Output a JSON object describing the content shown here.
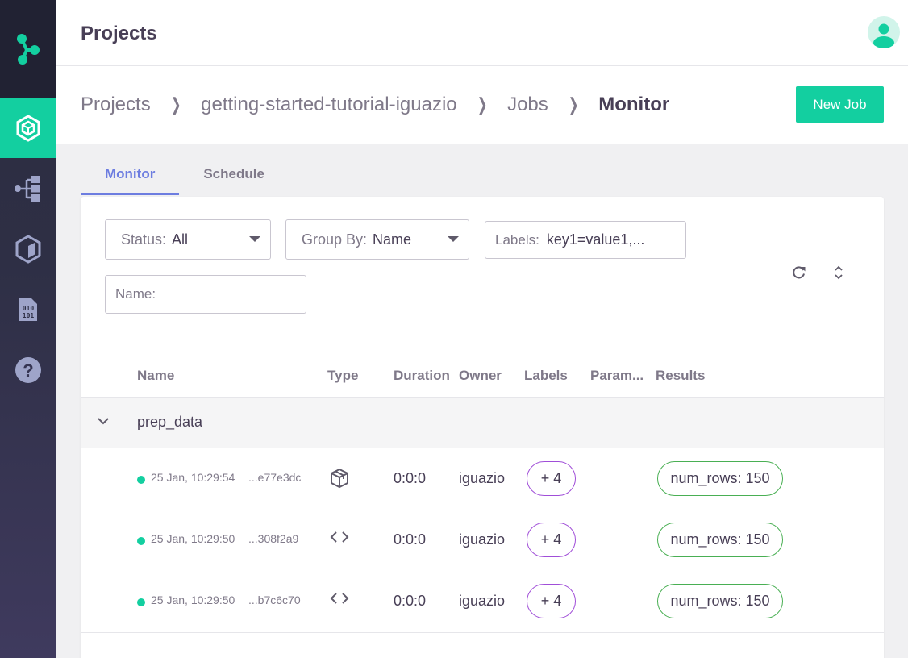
{
  "header": {
    "title": "Projects"
  },
  "breadcrumb": {
    "items": [
      "Projects",
      "getting-started-tutorial-iguazio",
      "Jobs",
      "Monitor"
    ]
  },
  "actions": {
    "new_job_label": "New Job"
  },
  "tabs": [
    {
      "label": "Monitor",
      "active": true
    },
    {
      "label": "Schedule",
      "active": false
    }
  ],
  "filters": {
    "status": {
      "label": "Status:",
      "value": "All"
    },
    "group_by": {
      "label": "Group By:",
      "value": "Name"
    },
    "labels": {
      "label": "Labels:",
      "placeholder": "key1=value1,..."
    },
    "name": {
      "label": "Name:",
      "value": ""
    }
  },
  "table": {
    "columns": [
      "Name",
      "Type",
      "Duration",
      "Owner",
      "Labels",
      "Param...",
      "Results"
    ],
    "group": {
      "name": "prep_data"
    },
    "rows": [
      {
        "date": "25 Jan, 10:29:54",
        "uid": "...e77e3dc",
        "type_icon": "package-icon",
        "duration": "0:0:0",
        "owner": "iguazio",
        "labels": "+ 4",
        "result": "num_rows: 150"
      },
      {
        "date": "25 Jan, 10:29:50",
        "uid": "...308f2a9",
        "type_icon": "code-icon",
        "duration": "0:0:0",
        "owner": "iguazio",
        "labels": "+ 4",
        "result": "num_rows: 150"
      },
      {
        "date": "25 Jan, 10:29:50",
        "uid": "...b7c6c70",
        "type_icon": "code-icon",
        "duration": "0:0:0",
        "owner": "iguazio",
        "labels": "+ 4",
        "result": "num_rows: 150"
      }
    ]
  },
  "colors": {
    "accent": "#13cfa0",
    "tab_active": "#6d7de0",
    "labels_chip": "#a04ed8",
    "results_chip": "#49af53"
  }
}
